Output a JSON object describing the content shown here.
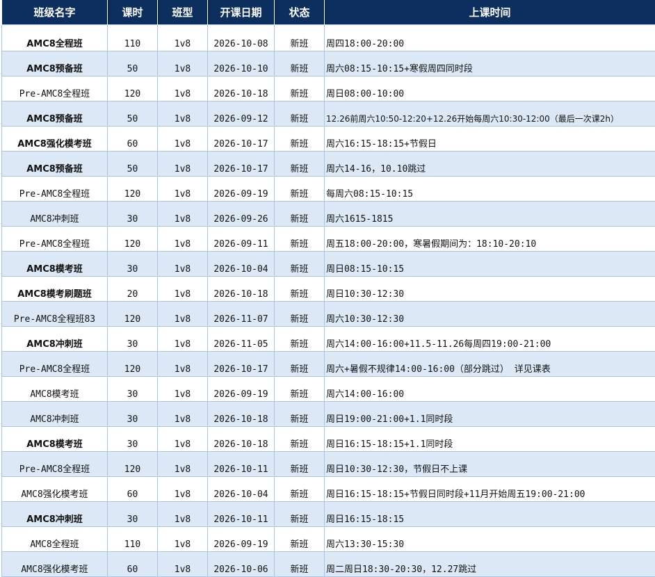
{
  "headers": [
    "班级名字",
    "课时",
    "班型",
    "开课日期",
    "状态",
    "上课时间"
  ],
  "rows": [
    {
      "name": "AMC8全程班",
      "hours": "110",
      "type": "1v8",
      "date": "2026-10-08",
      "status": "新班",
      "time": "周四18:00-20:00",
      "bold": true
    },
    {
      "name": "AMC8预备班",
      "hours": "50",
      "type": "1v8",
      "date": "2026-10-10",
      "status": "新班",
      "time": "周六08:15-10:15+寒假周四同时段",
      "bold": true
    },
    {
      "name": "Pre-AMC8全程班",
      "hours": "120",
      "type": "1v8",
      "date": "2026-10-18",
      "status": "新班",
      "time": "周日08:00-10:00",
      "bold": false
    },
    {
      "name": "AMC8预备班",
      "hours": "50",
      "type": "1v8",
      "date": "2026-09-12",
      "status": "新班",
      "time": "12.26前周六10:50-12:20+12.26开始每周六10:30-12:00（最后一次课2h）",
      "bold": true,
      "tight": true
    },
    {
      "name": "AMC8强化模考班",
      "hours": "60",
      "type": "1v8",
      "date": "2026-10-17",
      "status": "新班",
      "time": "周六16:15-18:15+节假日",
      "bold": true
    },
    {
      "name": "AMC8预备班",
      "hours": "50",
      "type": "1v8",
      "date": "2026-10-17",
      "status": "新班",
      "time": "周六14-16，10.10跳过",
      "bold": true
    },
    {
      "name": "Pre-AMC8全程班",
      "hours": "120",
      "type": "1v8",
      "date": "2026-09-19",
      "status": "新班",
      "time": "每周六08:15-10:15",
      "bold": false
    },
    {
      "name": "AMC8冲刺班",
      "hours": "30",
      "type": "1v8",
      "date": "2026-09-26",
      "status": "新班",
      "time": "周六1615-1815",
      "bold": false
    },
    {
      "name": "Pre-AMC8全程班",
      "hours": "120",
      "type": "1v8",
      "date": "2026-09-11",
      "status": "新班",
      "time": "周五18:00-20:00，寒暑假期间为：18:10-20:10",
      "bold": false
    },
    {
      "name": "AMC8模考班",
      "hours": "30",
      "type": "1v8",
      "date": "2026-10-04",
      "status": "新班",
      "time": "周日08:15-10:15",
      "bold": true
    },
    {
      "name": "AMC8模考刷题班",
      "hours": "20",
      "type": "1v8",
      "date": "2026-10-18",
      "status": "新班",
      "time": "周日10:30-12:30",
      "bold": true
    },
    {
      "name": "Pre-AMC8全程班83",
      "hours": "120",
      "type": "1v8",
      "date": "2026-11-07",
      "status": "新班",
      "time": "周六10:30-12:30",
      "bold": false
    },
    {
      "name": "AMC8冲刺班",
      "hours": "30",
      "type": "1v8",
      "date": "2026-11-05",
      "status": "新班",
      "time": "周六14:00-16:00+11.5-11.26每周四19:00-21:00",
      "bold": true
    },
    {
      "name": "Pre-AMC8全程班",
      "hours": "120",
      "type": "1v8",
      "date": "2026-10-17",
      "status": "新班",
      "time": "周六+暑假不规律14:00-16:00（部分跳过） 详见课表",
      "bold": false
    },
    {
      "name": "AMC8模考班",
      "hours": "30",
      "type": "1v8",
      "date": "2026-09-19",
      "status": "新班",
      "time": "周六14:00-16:00",
      "bold": false
    },
    {
      "name": "AMC8冲刺班",
      "hours": "30",
      "type": "1v8",
      "date": "2026-10-18",
      "status": "新班",
      "time": "周日19:00-21:00+1.1同时段",
      "bold": false
    },
    {
      "name": "AMC8模考班",
      "hours": "30",
      "type": "1v8",
      "date": "2026-10-18",
      "status": "新班",
      "time": "周日16:15-18:15+1.1同时段",
      "bold": true
    },
    {
      "name": "Pre-AMC8全程班",
      "hours": "120",
      "type": "1v8",
      "date": "2026-10-11",
      "status": "新班",
      "time": "周日10:30-12:30，节假日不上课",
      "bold": false
    },
    {
      "name": "AMC8强化模考班",
      "hours": "60",
      "type": "1v8",
      "date": "2026-10-04",
      "status": "新班",
      "time": "周日16:15-18:15+节假日同时段+11月开始周五19:00-21:00",
      "bold": false
    },
    {
      "name": "AMC8冲刺班",
      "hours": "30",
      "type": "1v8",
      "date": "2026-10-11",
      "status": "新班",
      "time": "周日16:15-18:15",
      "bold": true
    },
    {
      "name": "AMC8全程班",
      "hours": "110",
      "type": "1v8",
      "date": "2026-09-19",
      "status": "新班",
      "time": "周六13:30-15:30",
      "bold": false
    },
    {
      "name": "AMC8强化模考班",
      "hours": "60",
      "type": "1v8",
      "date": "2026-10-06",
      "status": "新班",
      "time": "周二周日18:30-20:30，12.27跳过",
      "bold": false
    }
  ]
}
